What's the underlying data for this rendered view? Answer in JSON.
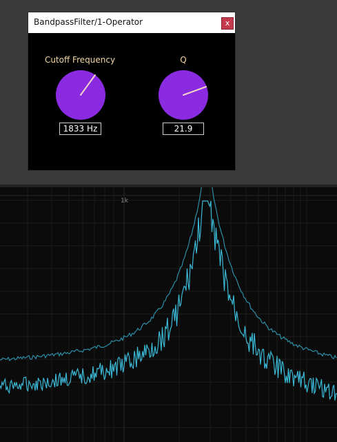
{
  "plugin": {
    "title": "BandpassFilter/1-Operator",
    "close_label": "x",
    "cutoff": {
      "label": "Cutoff Frequency",
      "value": "1833 Hz",
      "level": 0.62
    },
    "q": {
      "label": "Q",
      "value": "21.9",
      "level": 0.78
    }
  },
  "spectrum": {
    "grid_label_1k": "1k",
    "curve_color": "#3bb9d6",
    "peak_color": "#2c8ea8"
  },
  "colors": {
    "knob": "#8a2be2",
    "knob_indicator": "#f4d6c8",
    "label": "#f4d6a4"
  }
}
